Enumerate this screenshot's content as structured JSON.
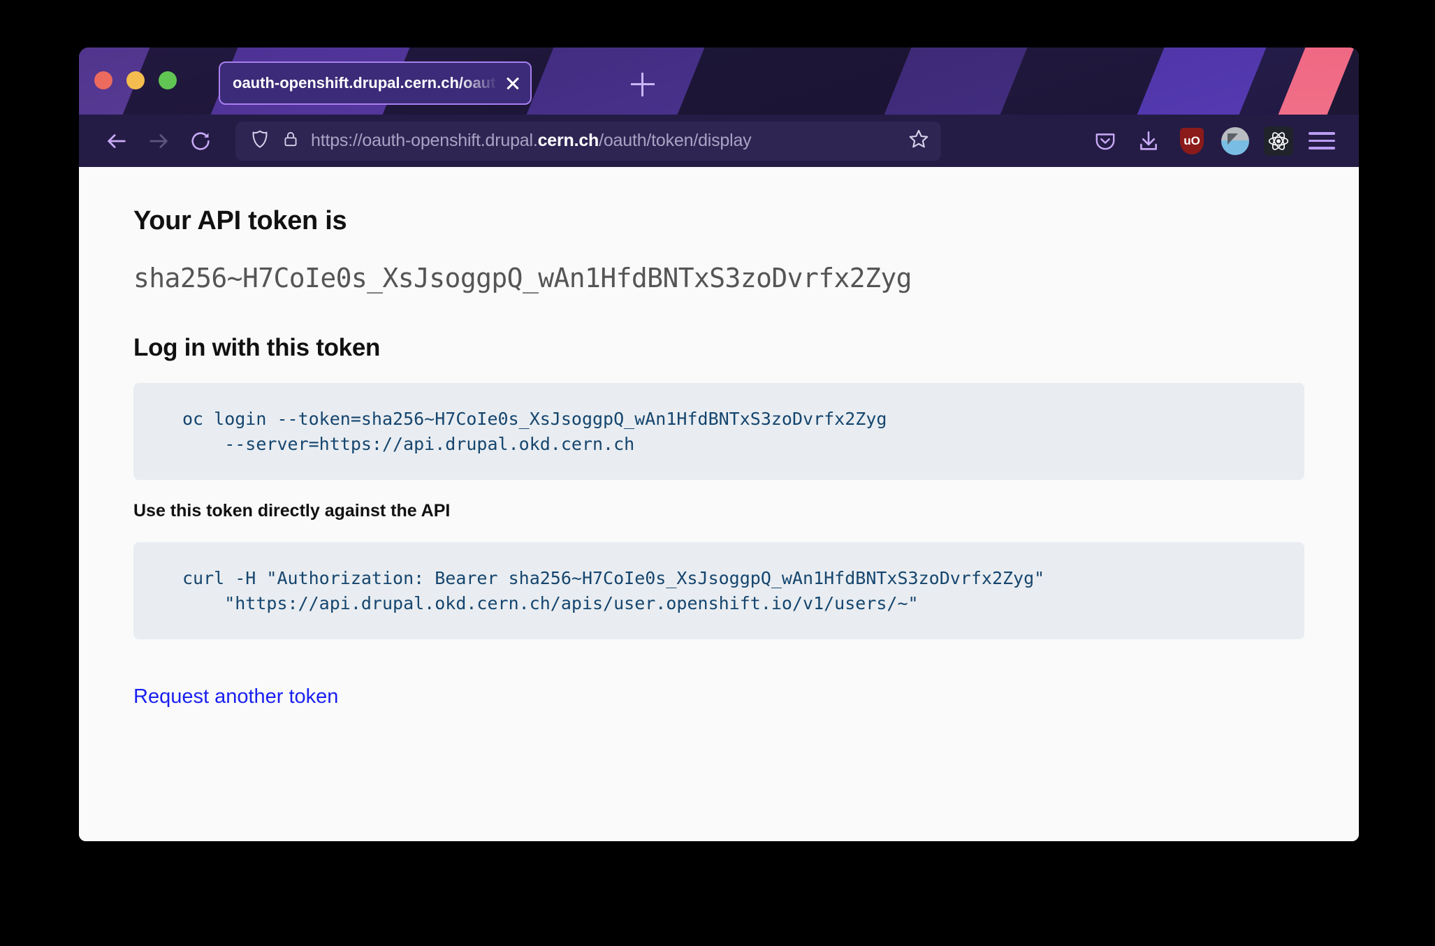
{
  "window": {
    "traffic_lights": [
      "close",
      "minimize",
      "maximize"
    ],
    "accent_purple": "#4b32a1",
    "accent_coral": "#ef6a8a"
  },
  "tab": {
    "title": "oauth-openshift.drupal.cern.ch/oaut",
    "close_label": "×",
    "new_tab_label": "+"
  },
  "toolbar": {
    "back_label": "Back",
    "forward_label": "Forward",
    "reload_label": "Reload",
    "shield_label": "Tracking protection",
    "lock_label": "Connection secure",
    "url_prefix": "https://oauth-openshift.drupal.",
    "url_host": "cern.ch",
    "url_suffix": "/oauth/token/display",
    "bookmark_label": "Bookmark this page",
    "pocket_label": "Save to Pocket",
    "downloads_label": "Downloads",
    "ublock_label": "uO",
    "ublock_title": "uBlock Origin",
    "circle_ext_label": "Extension",
    "react_ext_label": "React Developer Tools",
    "menu_label": "Open application menu"
  },
  "page": {
    "heading": "Your API token is",
    "token": "sha256~H7CoIe0s_XsJsoggpQ_wAn1HfdBNTxS3zoDvrfx2Zyg",
    "login_heading": "Log in with this token",
    "login_command": "oc login --token=sha256~H7CoIe0s_XsJsoggpQ_wAn1HfdBNTxS3zoDvrfx2Zyg\n    --server=https://api.drupal.okd.cern.ch",
    "api_heading": "Use this token directly against the API",
    "api_command": "curl -H \"Authorization: Bearer sha256~H7CoIe0s_XsJsoggpQ_wAn1HfdBNTxS3zoDvrfx2Zyg\"\n    \"https://api.drupal.okd.cern.ch/apis/user.openshift.io/v1/users/~\"",
    "request_link": "Request another token"
  }
}
